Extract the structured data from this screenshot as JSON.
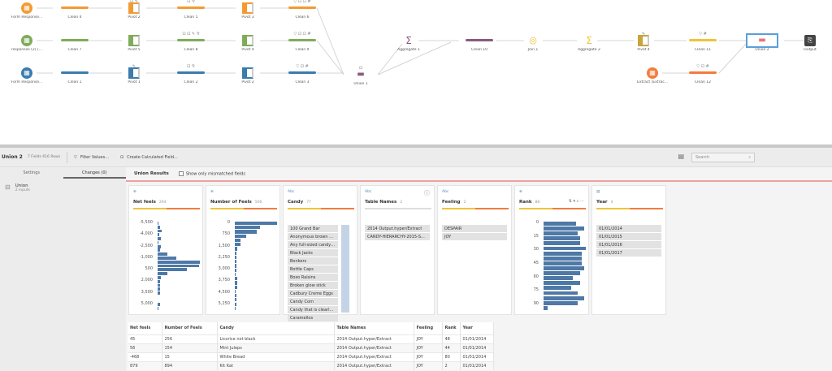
{
  "flow": {
    "nodes": [
      {
        "label": "Form Response...",
        "kind": "input",
        "color": "#f39b32",
        "ops": ""
      },
      {
        "label": "Clean 4",
        "kind": "clean",
        "color": "#f39b32",
        "ops": ""
      },
      {
        "label": "Pivot 2",
        "kind": "pivot",
        "color": "#f39b32",
        "ops": "⊡ ✎"
      },
      {
        "label": "Clean 5",
        "kind": "clean",
        "color": "#f39b32",
        "ops": "⊡ ⅋"
      },
      {
        "label": "Pivot 3",
        "kind": "pivot",
        "color": "#f39b32",
        "ops": ""
      },
      {
        "label": "Clean 6",
        "kind": "clean",
        "color": "#f39b32",
        "ops": "▽ ⊡ ⊡ #"
      },
      {
        "label": "responses (2) (...",
        "kind": "input",
        "color": "#7fac5a",
        "ops": ""
      },
      {
        "label": "Clean 7",
        "kind": "clean",
        "color": "#7fac5a",
        "ops": ""
      },
      {
        "label": "Pivot 5",
        "kind": "pivot",
        "color": "#7fac5a",
        "ops": ""
      },
      {
        "label": "Clean 8",
        "kind": "clean",
        "color": "#7fac5a",
        "ops": "⊡ ⊡ ✎ ⅋"
      },
      {
        "label": "Pivot 4",
        "kind": "pivot",
        "color": "#7fac5a",
        "ops": ""
      },
      {
        "label": "Clean 9",
        "kind": "clean",
        "color": "#7fac5a",
        "ops": "▽ ⊡ ⊡ #"
      },
      {
        "label": "Form Response...",
        "kind": "input",
        "color": "#3b7cad",
        "ops": ""
      },
      {
        "label": "Clean 1",
        "kind": "clean",
        "color": "#3b7cad",
        "ops": ""
      },
      {
        "label": "Pivot 1",
        "kind": "pivot",
        "color": "#3b7cad",
        "ops": "✎"
      },
      {
        "label": "Clean 2",
        "kind": "clean",
        "color": "#3b7cad",
        "ops": "⊡ ⅋"
      },
      {
        "label": "Pivot 2",
        "kind": "pivot",
        "color": "#3b7cad",
        "ops": ""
      },
      {
        "label": "Clean 3",
        "kind": "clean",
        "color": "#3b7cad",
        "ops": "▽ ⊡ #"
      },
      {
        "label": "Union 1",
        "kind": "union",
        "color": "#8a5a7e",
        "ops": "⊡"
      },
      {
        "label": "Aggregate 1",
        "kind": "aggregate",
        "color": "#8a5a7e",
        "ops": ""
      },
      {
        "label": "Clean 10",
        "kind": "clean",
        "color": "#8a5a7e",
        "ops": ""
      },
      {
        "label": "Join 1",
        "kind": "join",
        "color": "#e8c13a",
        "ops": ""
      },
      {
        "label": "Aggregate 2",
        "kind": "aggregate",
        "color": "#f0c43a",
        "ops": ""
      },
      {
        "label": "Pivot 4",
        "kind": "pivot",
        "color": "#c9a43a",
        "ops": "✎"
      },
      {
        "label": "Clean 11",
        "kind": "clean",
        "color": "#f0c43a",
        "ops": "▽ #"
      },
      {
        "label": "Union 2",
        "kind": "union",
        "color": "#e07a7a",
        "ops": ""
      },
      {
        "label": "Output",
        "kind": "output",
        "color": "#444444",
        "ops": ""
      },
      {
        "label": "Extract (Extrac...",
        "kind": "input",
        "color": "#f47c3c",
        "ops": ""
      },
      {
        "label": "Clean 12",
        "kind": "clean",
        "color": "#f47c3c",
        "ops": "▽ ⊡ #"
      }
    ]
  },
  "toolbar": {
    "step_name": "Union 2",
    "meta": "7 Fields  616 Rows",
    "filter": "Filter Values...",
    "calc": "Create Calculated Field...",
    "search_placeholder": "Search"
  },
  "left": {
    "tabs": [
      "Settings",
      "Changes (0)"
    ],
    "item": "Union",
    "item_sub": "2 inputs"
  },
  "main": {
    "results_label": "Union Results",
    "mismatch_label": "Show only mismatched fields"
  },
  "cards": [
    {
      "type": "⊕",
      "name": "Net feels",
      "count": "294",
      "ticks": [
        "-5,500",
        "-4,000",
        "-2,500",
        "-1,000",
        "500",
        "2,000",
        "3,500",
        "5,000"
      ],
      "bars": [
        0.02,
        0.06,
        0.1,
        0.04,
        0.08,
        0.02,
        0.07,
        0.05,
        0.24,
        0.44,
        1,
        0.98,
        0.7,
        0.24,
        0.08,
        0.06,
        0.05,
        0.06,
        0.06,
        0,
        0,
        0.06,
        0.01
      ]
    },
    {
      "type": "⊕",
      "name": "Number of Feels",
      "count": "506",
      "ticks": [
        "0",
        "750",
        "1,500",
        "2,250",
        "3,000",
        "3,750",
        "4,500",
        "5,250"
      ],
      "bars": [
        1,
        0.6,
        0.52,
        0.26,
        0.14,
        0.14,
        0.05,
        0.04,
        0.03,
        0.04,
        0.03,
        0.03,
        0.02,
        0.05,
        0.06,
        0.05,
        0.02,
        0.04,
        0.04,
        0.04,
        0.02
      ]
    },
    {
      "type": "Abc",
      "name": "Candy",
      "count": "77",
      "values": [
        "100 Grand Bar",
        "Anonymous brown glo...",
        "Any full-sized candy bar",
        "Black Jacks",
        "Bonkers",
        "Bottle Caps",
        "Boxo Raisins",
        "Broken glow stick",
        "Cadbury Creme Eggs",
        "Candy Corn",
        "Candy that is clearly ju...",
        "Caramellos"
      ]
    },
    {
      "type": "Abc",
      "name": "Table Names",
      "count": "2",
      "values": [
        "2014 Output.hyper/Extract",
        "CANDY-HIERARCHY-2015-S..."
      ]
    },
    {
      "type": "Abc",
      "name": "Feeling",
      "count": "2",
      "values": [
        "DESPAIR",
        "JOY"
      ]
    },
    {
      "type": "⊕",
      "name": "Rank",
      "count": "88",
      "ticks": [
        "0",
        "15",
        "30",
        "45",
        "60",
        "75",
        "90"
      ],
      "bars": [
        0.76,
        0.96,
        0.8,
        0.86,
        0.86,
        1,
        0.9,
        0.9,
        0.9,
        0.96,
        0.86,
        0.7,
        0.86,
        0.66,
        0.8,
        0.96,
        0.8,
        0.1
      ]
    },
    {
      "type": "▤",
      "name": "Year",
      "count": "4",
      "values": [
        "01/01/2014",
        "01/01/2015",
        "01/01/2016",
        "01/01/2017"
      ]
    }
  ],
  "table": {
    "columns": [
      "Net feels",
      "Number of Feels",
      "Candy",
      "Table Names",
      "Feeling",
      "Rank",
      "Year"
    ],
    "rows": [
      [
        "45",
        "256",
        "Licorice not black",
        "2014 Output.hyper/Extract",
        "JOY",
        "48",
        "01/01/2014"
      ],
      [
        "56",
        "154",
        "Mint Juleps",
        "2014 Output.hyper/Extract",
        "JOY",
        "44",
        "01/01/2014"
      ],
      [
        "-468",
        "15",
        "White Bread",
        "2014 Output.hyper/Extract",
        "JOY",
        "80",
        "01/01/2014"
      ],
      [
        "879",
        "894",
        "Kit Kat",
        "2014 Output.hyper/Extract",
        "JOY",
        "2",
        "01/01/2014"
      ]
    ]
  }
}
